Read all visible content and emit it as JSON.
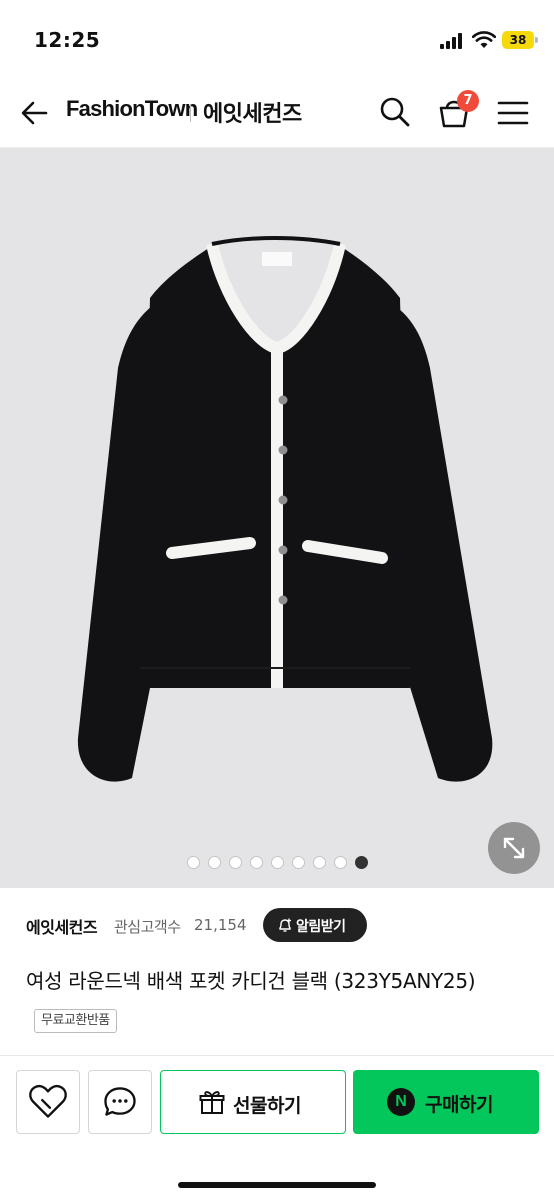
{
  "status": {
    "time": "12:25",
    "battery": "38"
  },
  "header": {
    "logo": "FashionTown",
    "brand": "에잇세컨즈",
    "cart_count": "7"
  },
  "gallery": {
    "total_images": 9,
    "active_index": 8
  },
  "product": {
    "brand": "에잇세컨즈",
    "fans_label": "관심고객수",
    "fans_count": "21,154",
    "alarm_label": "알림받기",
    "title": "여성 라운드넥 배색 포켓 카디건 블랙 (323Y5ANY25)",
    "badge": "무료교환반품",
    "image_colors": {
      "background": "#e4e4e6",
      "garment": "#121214",
      "trim": "#f4f4f2"
    }
  },
  "bottom_bar": {
    "gift_label": "선물하기",
    "buy_label": "구매하기",
    "naver_glyph": "N",
    "accent": "#03c75a"
  }
}
